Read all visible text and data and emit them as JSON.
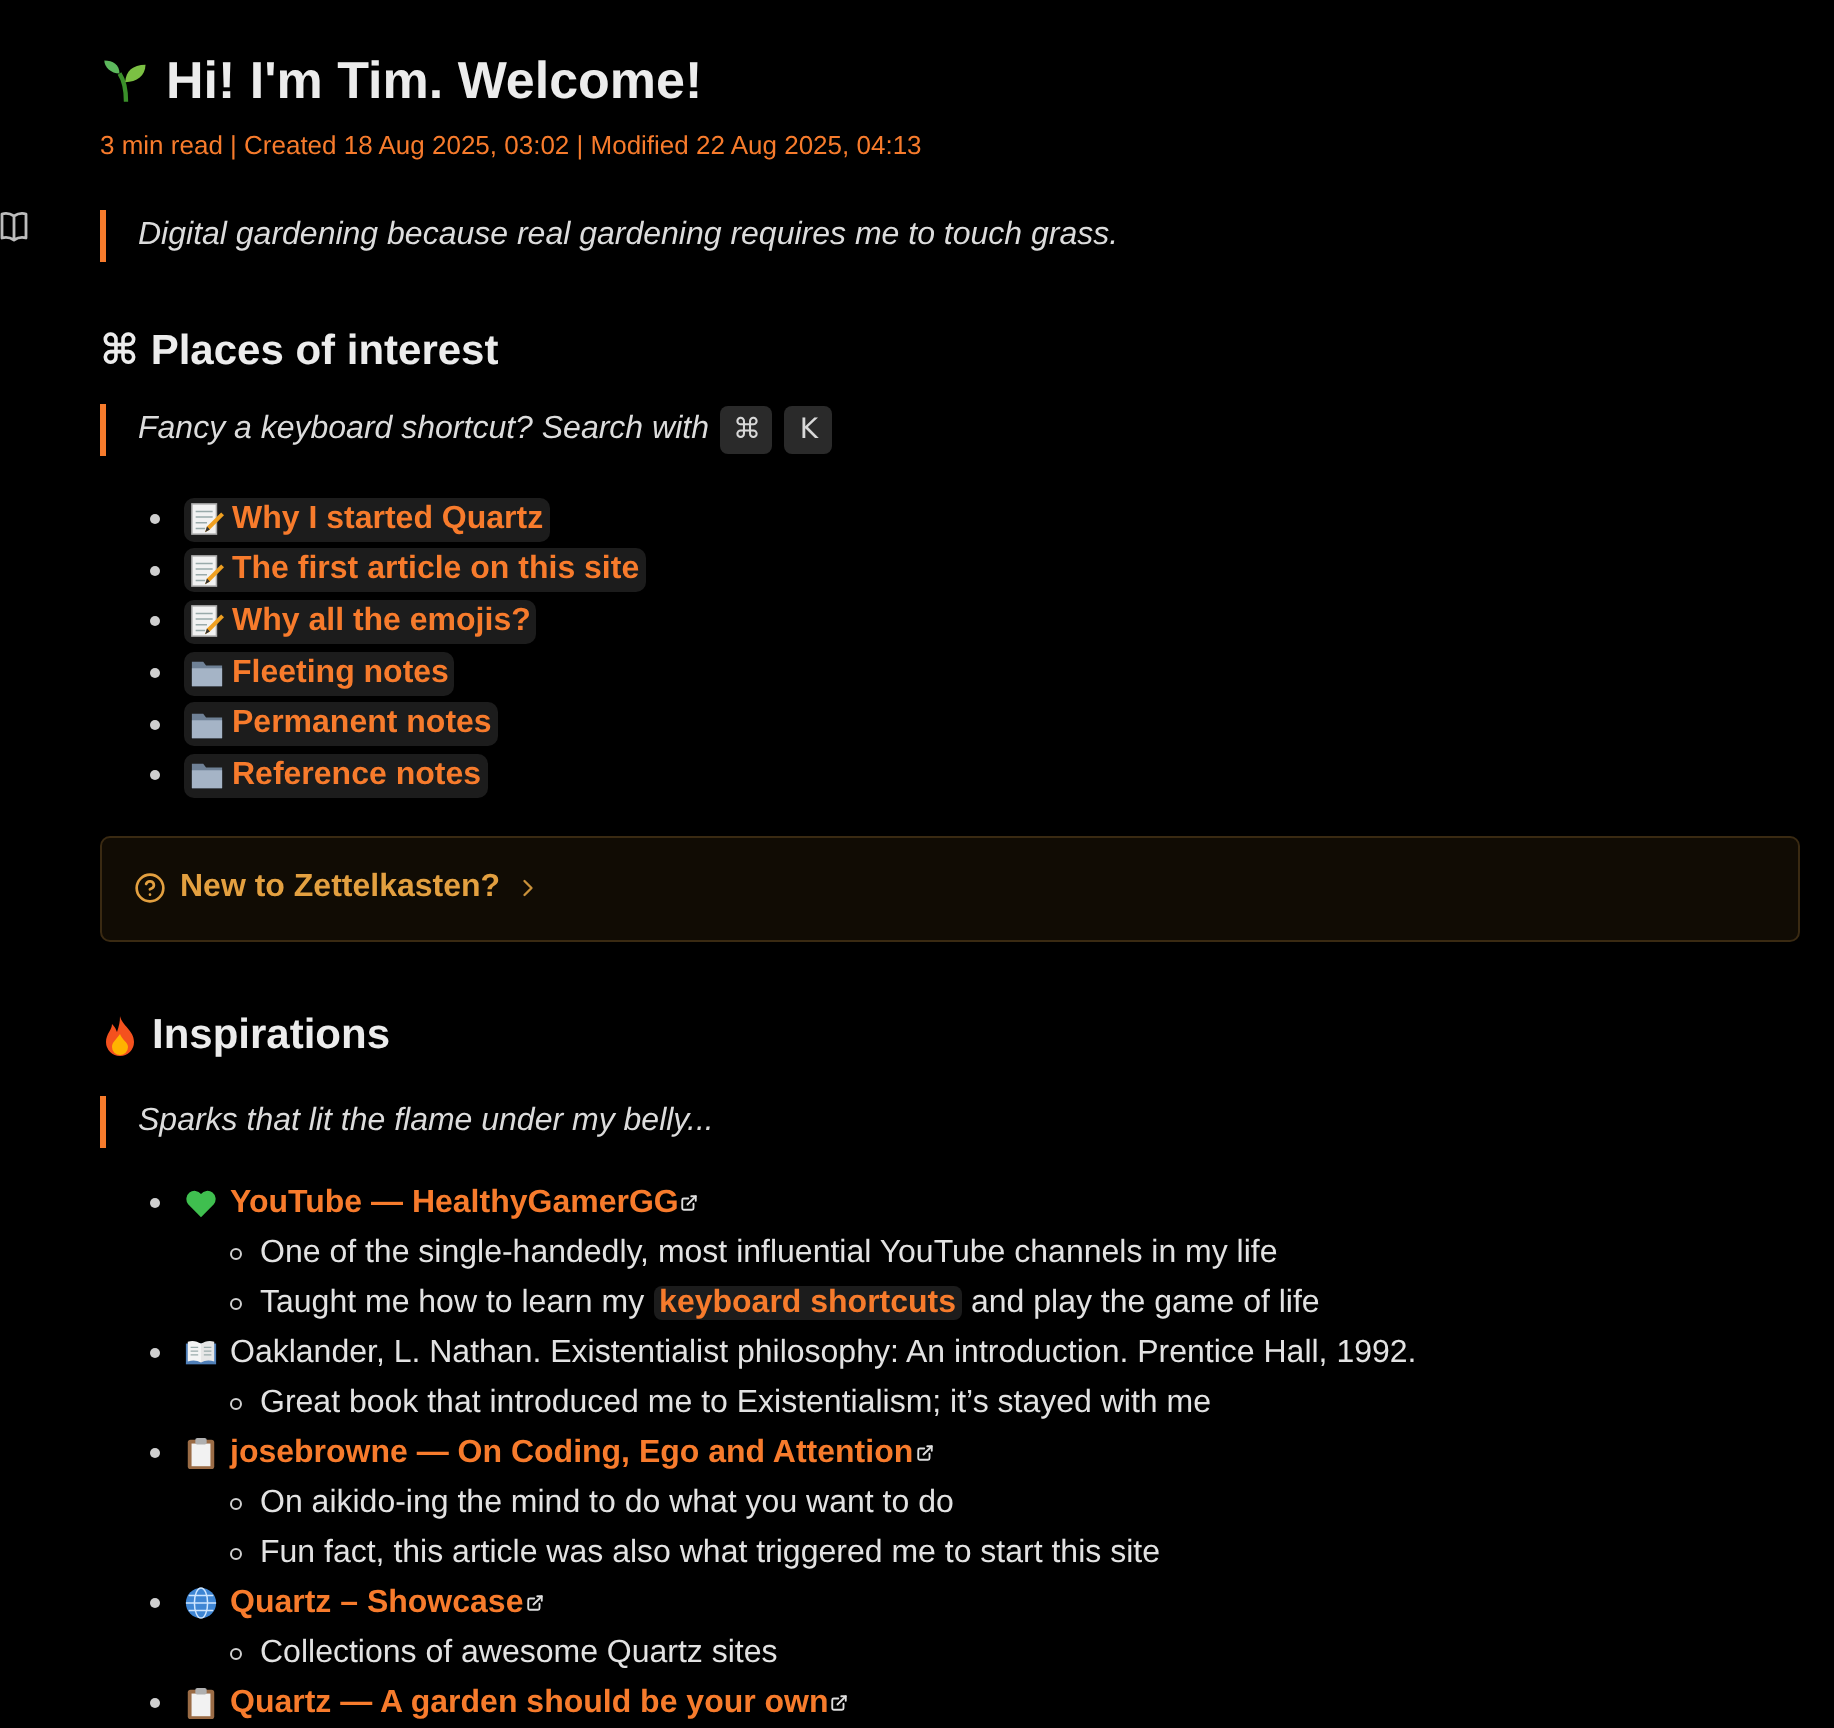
{
  "page": {
    "title": "Hi! I'm Tim. Welcome!",
    "meta": "3 min read | Created 18 Aug 2025, 03:02 | Modified 22 Aug 2025, 04:13",
    "quote": "Digital gardening because real gardening requires me to touch grass."
  },
  "places": {
    "heading": "⌘ Places of interest",
    "quote": "Fancy a keyboard shortcut? Search with",
    "keys": [
      "⌘",
      "K"
    ],
    "links": [
      {
        "kind": "note",
        "label": "Why I started Quartz"
      },
      {
        "kind": "note",
        "label": "The first article on this site"
      },
      {
        "kind": "note",
        "label": "Why all the emojis?"
      },
      {
        "kind": "folder",
        "label": "Fleeting notes"
      },
      {
        "kind": "folder",
        "label": "Permanent notes"
      },
      {
        "kind": "folder",
        "label": "Reference notes"
      }
    ]
  },
  "callout": {
    "title": "New to Zettelkasten?",
    "expanded": false
  },
  "inspirations": {
    "heading": "Inspirations",
    "quote": "Sparks that lit the flame under my belly...",
    "items": [
      {
        "kind": "video",
        "label": "YouTube — HealthyGamerGG",
        "external": true,
        "children": [
          {
            "parts": [
              {
                "kind": "text",
                "text": "One of the single-handedly, most influential YouTube channels in my life"
              }
            ]
          },
          {
            "parts": [
              {
                "kind": "text",
                "text": "Taught me how to learn my "
              },
              {
                "kind": "link",
                "text": "keyboard shortcuts"
              },
              {
                "kind": "text",
                "text": " and play the game of life"
              }
            ]
          }
        ]
      },
      {
        "kind": "book",
        "label": "Oaklander, L. Nathan. Existentialist philosophy: An introduction. Prentice Hall, 1992.",
        "external": false,
        "children": [
          {
            "parts": [
              {
                "kind": "text",
                "text": "Great book that introduced me to Existentialism; it’s stayed with me"
              }
            ]
          }
        ]
      },
      {
        "kind": "article",
        "label": "josebrowne — On Coding, Ego and Attention",
        "external": true,
        "children": [
          {
            "parts": [
              {
                "kind": "text",
                "text": "On aikido-ing the mind to do what you want to do"
              }
            ]
          },
          {
            "parts": [
              {
                "kind": "text",
                "text": "Fun fact, this article was also what triggered me to start this site"
              }
            ]
          }
        ]
      },
      {
        "kind": "website",
        "label": "Quartz – Showcase",
        "external": true,
        "children": [
          {
            "parts": [
              {
                "kind": "text",
                "text": "Collections of awesome Quartz sites"
              }
            ]
          }
        ]
      },
      {
        "kind": "article",
        "label": "Quartz — A garden should be your own",
        "external": true
      }
    ]
  }
}
